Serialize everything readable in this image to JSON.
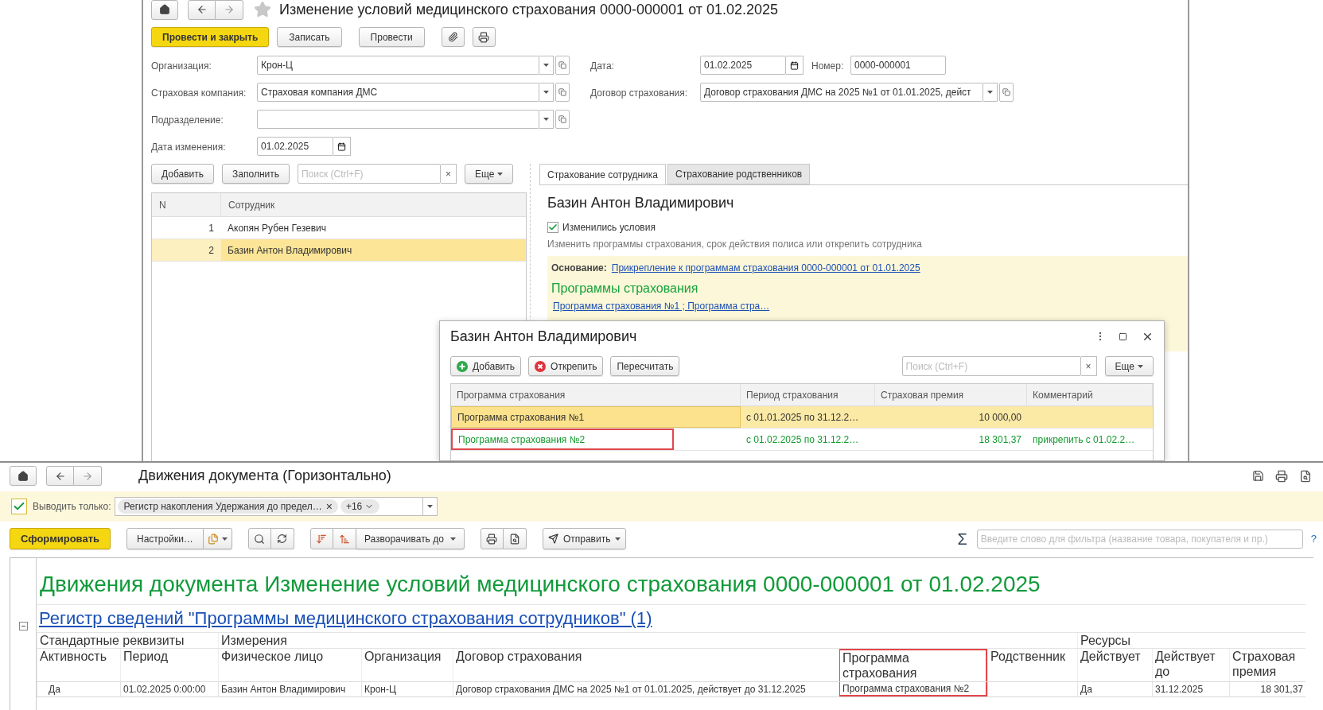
{
  "document_window": {
    "title": "Изменение условий медицинского страхования 0000-000001 от 01.02.2025",
    "actions": [
      {
        "label": "Провести и закрыть",
        "kind": "primary"
      },
      {
        "label": "Записать",
        "kind": "default"
      },
      {
        "label": "Провести",
        "kind": "default"
      }
    ],
    "organization": {
      "label": "Организация:",
      "value": "Крон-Ц"
    },
    "date": {
      "label": "Дата:",
      "value": "01.02.2025"
    },
    "number": {
      "label": "Номер:",
      "value": "0000-000001"
    },
    "insurer": {
      "label": "Страховая компания:",
      "value": "Страховая компания ДМС"
    },
    "contract": {
      "label": "Договор страхования:",
      "value": "Договор страхования ДМС на 2025 №1 от 01.01.2025, дейст"
    },
    "department": {
      "label": "Подразделение:"
    },
    "change_date": {
      "label": "Дата изменения:",
      "value": "01.02.2025"
    },
    "employee_toolbar": {
      "buttons": [
        "Добавить",
        "Заполнить"
      ],
      "search_placeholder": "Поиск (Ctrl+F)",
      "clear": "×",
      "more": "Еще"
    },
    "employees": {
      "columns": [
        "N",
        "Сотрудник"
      ],
      "rows": [
        {
          "n": "1",
          "name": "Акопян Рубен Гезевич",
          "selected": false
        },
        {
          "n": "2",
          "name": "Базин Антон Владимирович",
          "selected": true
        }
      ]
    },
    "tabs": [
      {
        "label": "Страхование сотрудника",
        "selected": true
      },
      {
        "label": "Страхование родственников",
        "selected": false
      }
    ],
    "employee_panel": {
      "name": "Базин Антон Владимирович",
      "conditions_changed": {
        "label": "Изменились условия",
        "checked": true
      },
      "hint": "Изменить программы страхования, срок действия полиса или открепить сотрудника",
      "basis_label": "Основание:",
      "basis_link": "Прикрепление к программам страхования 0000-000001 от 01.01.2025",
      "programs_heading": "Программы страхования",
      "programs_link": "Программа страхования №1 ; Программа стра…"
    }
  },
  "dialog": {
    "title": "Базин Антон Владимирович",
    "buttons": [
      {
        "label": "Добавить",
        "kind": "add"
      },
      {
        "label": "Открепить",
        "kind": "remove"
      },
      {
        "label": "Пересчитать",
        "kind": "plain"
      }
    ],
    "search_placeholder": "Поиск (Ctrl+F)",
    "clear": "×",
    "more": "Еще",
    "columns": [
      "Программа страхования",
      "Период страхования",
      "Страховая премия",
      "Комментарий"
    ],
    "rows": [
      {
        "program": "Программа страхования №1",
        "period": "с 01.01.2025 по 31.12.2…",
        "premium": "10 000,00",
        "selected": true,
        "added": false,
        "highlighted": false
      },
      {
        "program": "Программа страхования №2",
        "period": "с 01.02.2025 по 31.12.2…",
        "premium": "18 301,37",
        "comment": "прикрепить с 01.02.2…",
        "selected": false,
        "added": true,
        "highlighted": true
      }
    ]
  },
  "report_window": {
    "title": "Движения документа (Горизонтально)",
    "filter": {
      "checked": true,
      "label": "Выводить только:",
      "tag": "Регистр накопления Удержания до предел…",
      "tag_clear": "×",
      "more_count": "+16"
    },
    "toolbar": {
      "generate": "Сформировать",
      "settings": "Настройки…",
      "expand": "Разворачивать до",
      "send": "Отправить"
    },
    "sum_symbol": "Σ",
    "filter_placeholder": "Введите слово для фильтра (название товара, покупателя и пр.)",
    "help": "?",
    "heading": "Движения документа Изменение условий медицинского страхования 0000-000001 от 01.02.2025",
    "register_link": "Регистр сведений \"Программы медицинского страхования сотрудников\" (1)",
    "groups": [
      {
        "label": "Стандартные реквизиты",
        "columns": [
          {
            "label": "Активность",
            "highlighted": false
          },
          {
            "label": "Период",
            "highlighted": false
          }
        ]
      },
      {
        "label": "Измерения",
        "columns": [
          {
            "label": "Физическое лицо",
            "highlighted": false
          },
          {
            "label": "Организация",
            "highlighted": false
          },
          {
            "label": "Договор страхования",
            "highlighted": false
          },
          {
            "label": "Программа страхования",
            "highlighted": true
          },
          {
            "label": "Родственник",
            "highlighted": false
          }
        ]
      },
      {
        "label": "Ресурсы",
        "columns": [
          {
            "label": "Действует",
            "highlighted": false
          },
          {
            "label": "Действует до",
            "highlighted": false
          },
          {
            "label": "Страховая премия",
            "highlighted": false
          }
        ]
      }
    ],
    "rows": [
      {
        "cells": [
          "Да",
          "01.02.2025 0:00:00",
          "Базин Антон Владимирович",
          "Крон-Ц",
          "Договор страхования ДМС на 2025 №1 от 01.01.2025, действует до 31.12.2025",
          "Программа страхования №2",
          "",
          "Да",
          "31.12.2025",
          "18 301,37"
        ]
      }
    ]
  }
}
